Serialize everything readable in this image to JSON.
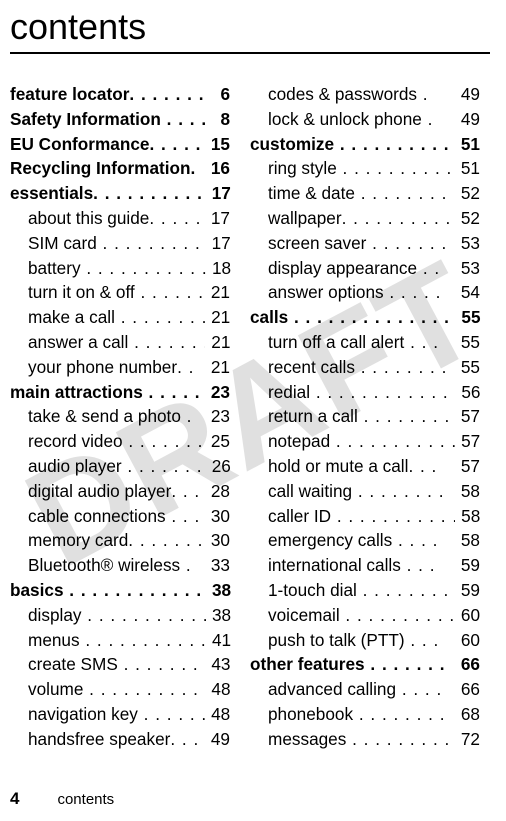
{
  "title": "contents",
  "watermark": "DRAFT",
  "footer": {
    "page_number": "4",
    "label": "contents"
  },
  "left": [
    {
      "type": "section",
      "label": "feature locator",
      "dots": ". . . . . . . .",
      "page": "6"
    },
    {
      "type": "section",
      "label": "Safety Information",
      "dots": " . . . .",
      "page": "8"
    },
    {
      "type": "section",
      "label": "EU Conformance",
      "dots": ". . . . .",
      "page": "15"
    },
    {
      "type": "section",
      "label": "Recycling Information",
      "dots": ".",
      "page": "16"
    },
    {
      "type": "section",
      "label": "essentials",
      "dots": ". . . . . . . . . . .",
      "page": "17"
    },
    {
      "type": "sub",
      "label": "about this guide",
      "dots": ". . . . .",
      "page": "17"
    },
    {
      "type": "sub",
      "label": "SIM card",
      "dots": " . . . . . . . . . .",
      "page": "17"
    },
    {
      "type": "sub",
      "label": "battery",
      "dots": " . . . . . . . . . . . .",
      "page": "18"
    },
    {
      "type": "sub",
      "label": "turn it on & off",
      "dots": " . . . . . .",
      "page": "21"
    },
    {
      "type": "sub",
      "label": "make a call",
      "dots": "  . . . . . . . .",
      "page": "21"
    },
    {
      "type": "sub",
      "label": "answer a call",
      "dots": " . . . . . . .",
      "page": "21"
    },
    {
      "type": "sub",
      "label": "your phone number",
      "dots": ". .",
      "page": "21"
    },
    {
      "type": "section",
      "label": "main attractions",
      "dots": " . . . . .",
      "page": "23"
    },
    {
      "type": "sub",
      "label": "take & send a photo",
      "dots": "  .",
      "page": "23"
    },
    {
      "type": "sub",
      "label": "record video",
      "dots": "  . . . . . . .",
      "page": "25"
    },
    {
      "type": "sub",
      "label": "audio player",
      "dots": " . . . . . . . .",
      "page": "26"
    },
    {
      "type": "sub",
      "label": "digital audio player",
      "dots": ". . .",
      "page": "28"
    },
    {
      "type": "sub",
      "label": "cable connections",
      "dots": " . . .",
      "page": "30"
    },
    {
      "type": "sub",
      "label": "memory card",
      "dots": ". . . . . . .",
      "page": "30"
    },
    {
      "type": "sub",
      "label": "Bluetooth® wireless",
      "dots": " .",
      "page": "33"
    },
    {
      "type": "section",
      "label": "basics",
      "dots": " . . . . . . . . . . . . . .",
      "page": "38"
    },
    {
      "type": "sub",
      "label": "display",
      "dots": " . . . . . . . . . . . .",
      "page": "38"
    },
    {
      "type": "sub",
      "label": "menus",
      "dots": " . . . . . . . . . . . .",
      "page": "41"
    },
    {
      "type": "sub",
      "label": "create SMS",
      "dots": " . . . . . . . .",
      "page": "43"
    },
    {
      "type": "sub",
      "label": "volume",
      "dots": "  . . . . . . . . . . .",
      "page": "48"
    },
    {
      "type": "sub",
      "label": "navigation key",
      "dots": " . . . . . .",
      "page": "48"
    },
    {
      "type": "sub",
      "label": "handsfree speaker",
      "dots": ". . .",
      "page": "49"
    }
  ],
  "right": [
    {
      "type": "sub",
      "label": "codes & passwords",
      "dots": "  .",
      "page": "49"
    },
    {
      "type": "sub",
      "label": "lock & unlock phone",
      "dots": "  .",
      "page": "49"
    },
    {
      "type": "section",
      "label": "customize",
      "dots": "  . . . . . . . . . .",
      "page": "51"
    },
    {
      "type": "sub",
      "label": "ring style",
      "dots": " . . . . . . . . . .",
      "page": "51"
    },
    {
      "type": "sub",
      "label": "time & date",
      "dots": " . . . . . . . .",
      "page": "52"
    },
    {
      "type": "sub",
      "label": "wallpaper",
      "dots": ". . . . . . . . . .",
      "page": "52"
    },
    {
      "type": "sub",
      "label": "screen saver",
      "dots": " . . . . . . .",
      "page": "53"
    },
    {
      "type": "sub",
      "label": "display appearance",
      "dots": " . .",
      "page": "53"
    },
    {
      "type": "sub",
      "label": "answer options",
      "dots": " . . . . .",
      "page": "54"
    },
    {
      "type": "section",
      "label": "calls",
      "dots": "  . . . . . . . . . . . . . . .",
      "page": "55"
    },
    {
      "type": "sub",
      "label": "turn off a call alert",
      "dots": " . . .",
      "page": "55"
    },
    {
      "type": "sub",
      "label": "recent calls",
      "dots": "  . . . . . . . .",
      "page": "55"
    },
    {
      "type": "sub",
      "label": "redial",
      "dots": " . . . . . . . . . . . . .",
      "page": "56"
    },
    {
      "type": "sub",
      "label": "return a call",
      "dots": " . . . . . . . .",
      "page": "57"
    },
    {
      "type": "sub",
      "label": "notepad",
      "dots": " . . . . . . . . . . .",
      "page": "57"
    },
    {
      "type": "sub",
      "label": "hold or mute a call",
      "dots": ". . .",
      "page": "57"
    },
    {
      "type": "sub",
      "label": "call waiting",
      "dots": "  . . . . . . . .",
      "page": "58"
    },
    {
      "type": "sub",
      "label": "caller ID",
      "dots": " . . . . . . . . . . .",
      "page": "58"
    },
    {
      "type": "sub",
      "label": "emergency calls",
      "dots": "  . . . .",
      "page": "58"
    },
    {
      "type": "sub",
      "label": "international calls",
      "dots": "  . . .",
      "page": "59"
    },
    {
      "type": "sub",
      "label": "1-touch dial",
      "dots": "  . . . . . . . .",
      "page": "59"
    },
    {
      "type": "sub",
      "label": "voicemail",
      "dots": " . . . . . . . . . .",
      "page": "60"
    },
    {
      "type": "sub",
      "label": "push to talk (PTT)",
      "dots": "  . . .",
      "page": "60"
    },
    {
      "type": "section",
      "label": "other features",
      "dots": "  . . . . . . .",
      "page": "66"
    },
    {
      "type": "sub",
      "label": "advanced calling",
      "dots": "  . . . .",
      "page": "66"
    },
    {
      "type": "sub",
      "label": "phonebook",
      "dots": "  . . . . . . . .",
      "page": "68"
    },
    {
      "type": "sub",
      "label": "messages",
      "dots": "  . . . . . . . . .",
      "page": "72"
    }
  ]
}
